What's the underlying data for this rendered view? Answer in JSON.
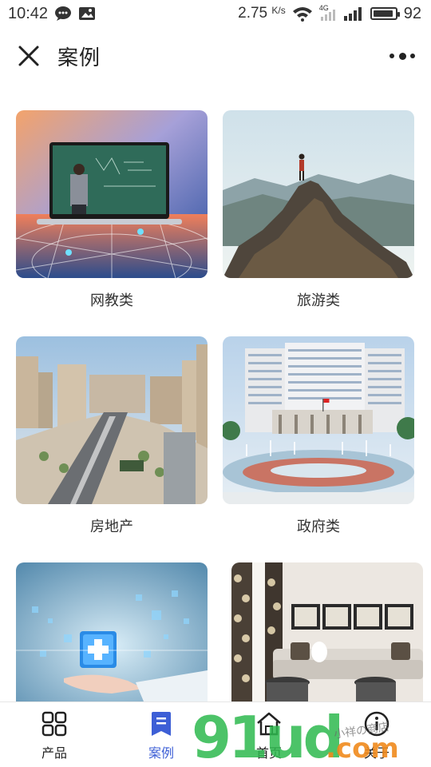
{
  "status_bar": {
    "time": "10:42",
    "net_speed": "2.75",
    "net_unit": "K/s",
    "network_type": "4G",
    "battery_level": "92"
  },
  "header": {
    "title": "案例"
  },
  "cases": [
    {
      "label": "网教类",
      "image": "online-education-teacher-laptop"
    },
    {
      "label": "旅游类",
      "image": "hiker-on-mountain-peak"
    },
    {
      "label": "房地产",
      "image": "city-real-estate-aerial"
    },
    {
      "label": "政府类",
      "image": "government-building-fountain"
    },
    {
      "label": "",
      "image": "medical-cross-hand"
    },
    {
      "label": "",
      "image": "living-room-interior"
    }
  ],
  "bottom_nav": [
    {
      "label": "产品",
      "icon": "grid-icon",
      "active": false
    },
    {
      "label": "案例",
      "icon": "bookmark-icon",
      "active": true
    },
    {
      "label": "首页",
      "icon": "home-icon",
      "active": false
    },
    {
      "label": "关于",
      "icon": "info-icon",
      "active": false
    }
  ],
  "colors": {
    "accent": "#3d5fd6",
    "text": "#222222",
    "watermark_green": "#2db84d",
    "watermark_orange": "#f08a1c"
  },
  "watermark": {
    "brand_main": "91ud",
    "brand_suffix": ".com",
    "handwritten": "小祥の商店"
  }
}
